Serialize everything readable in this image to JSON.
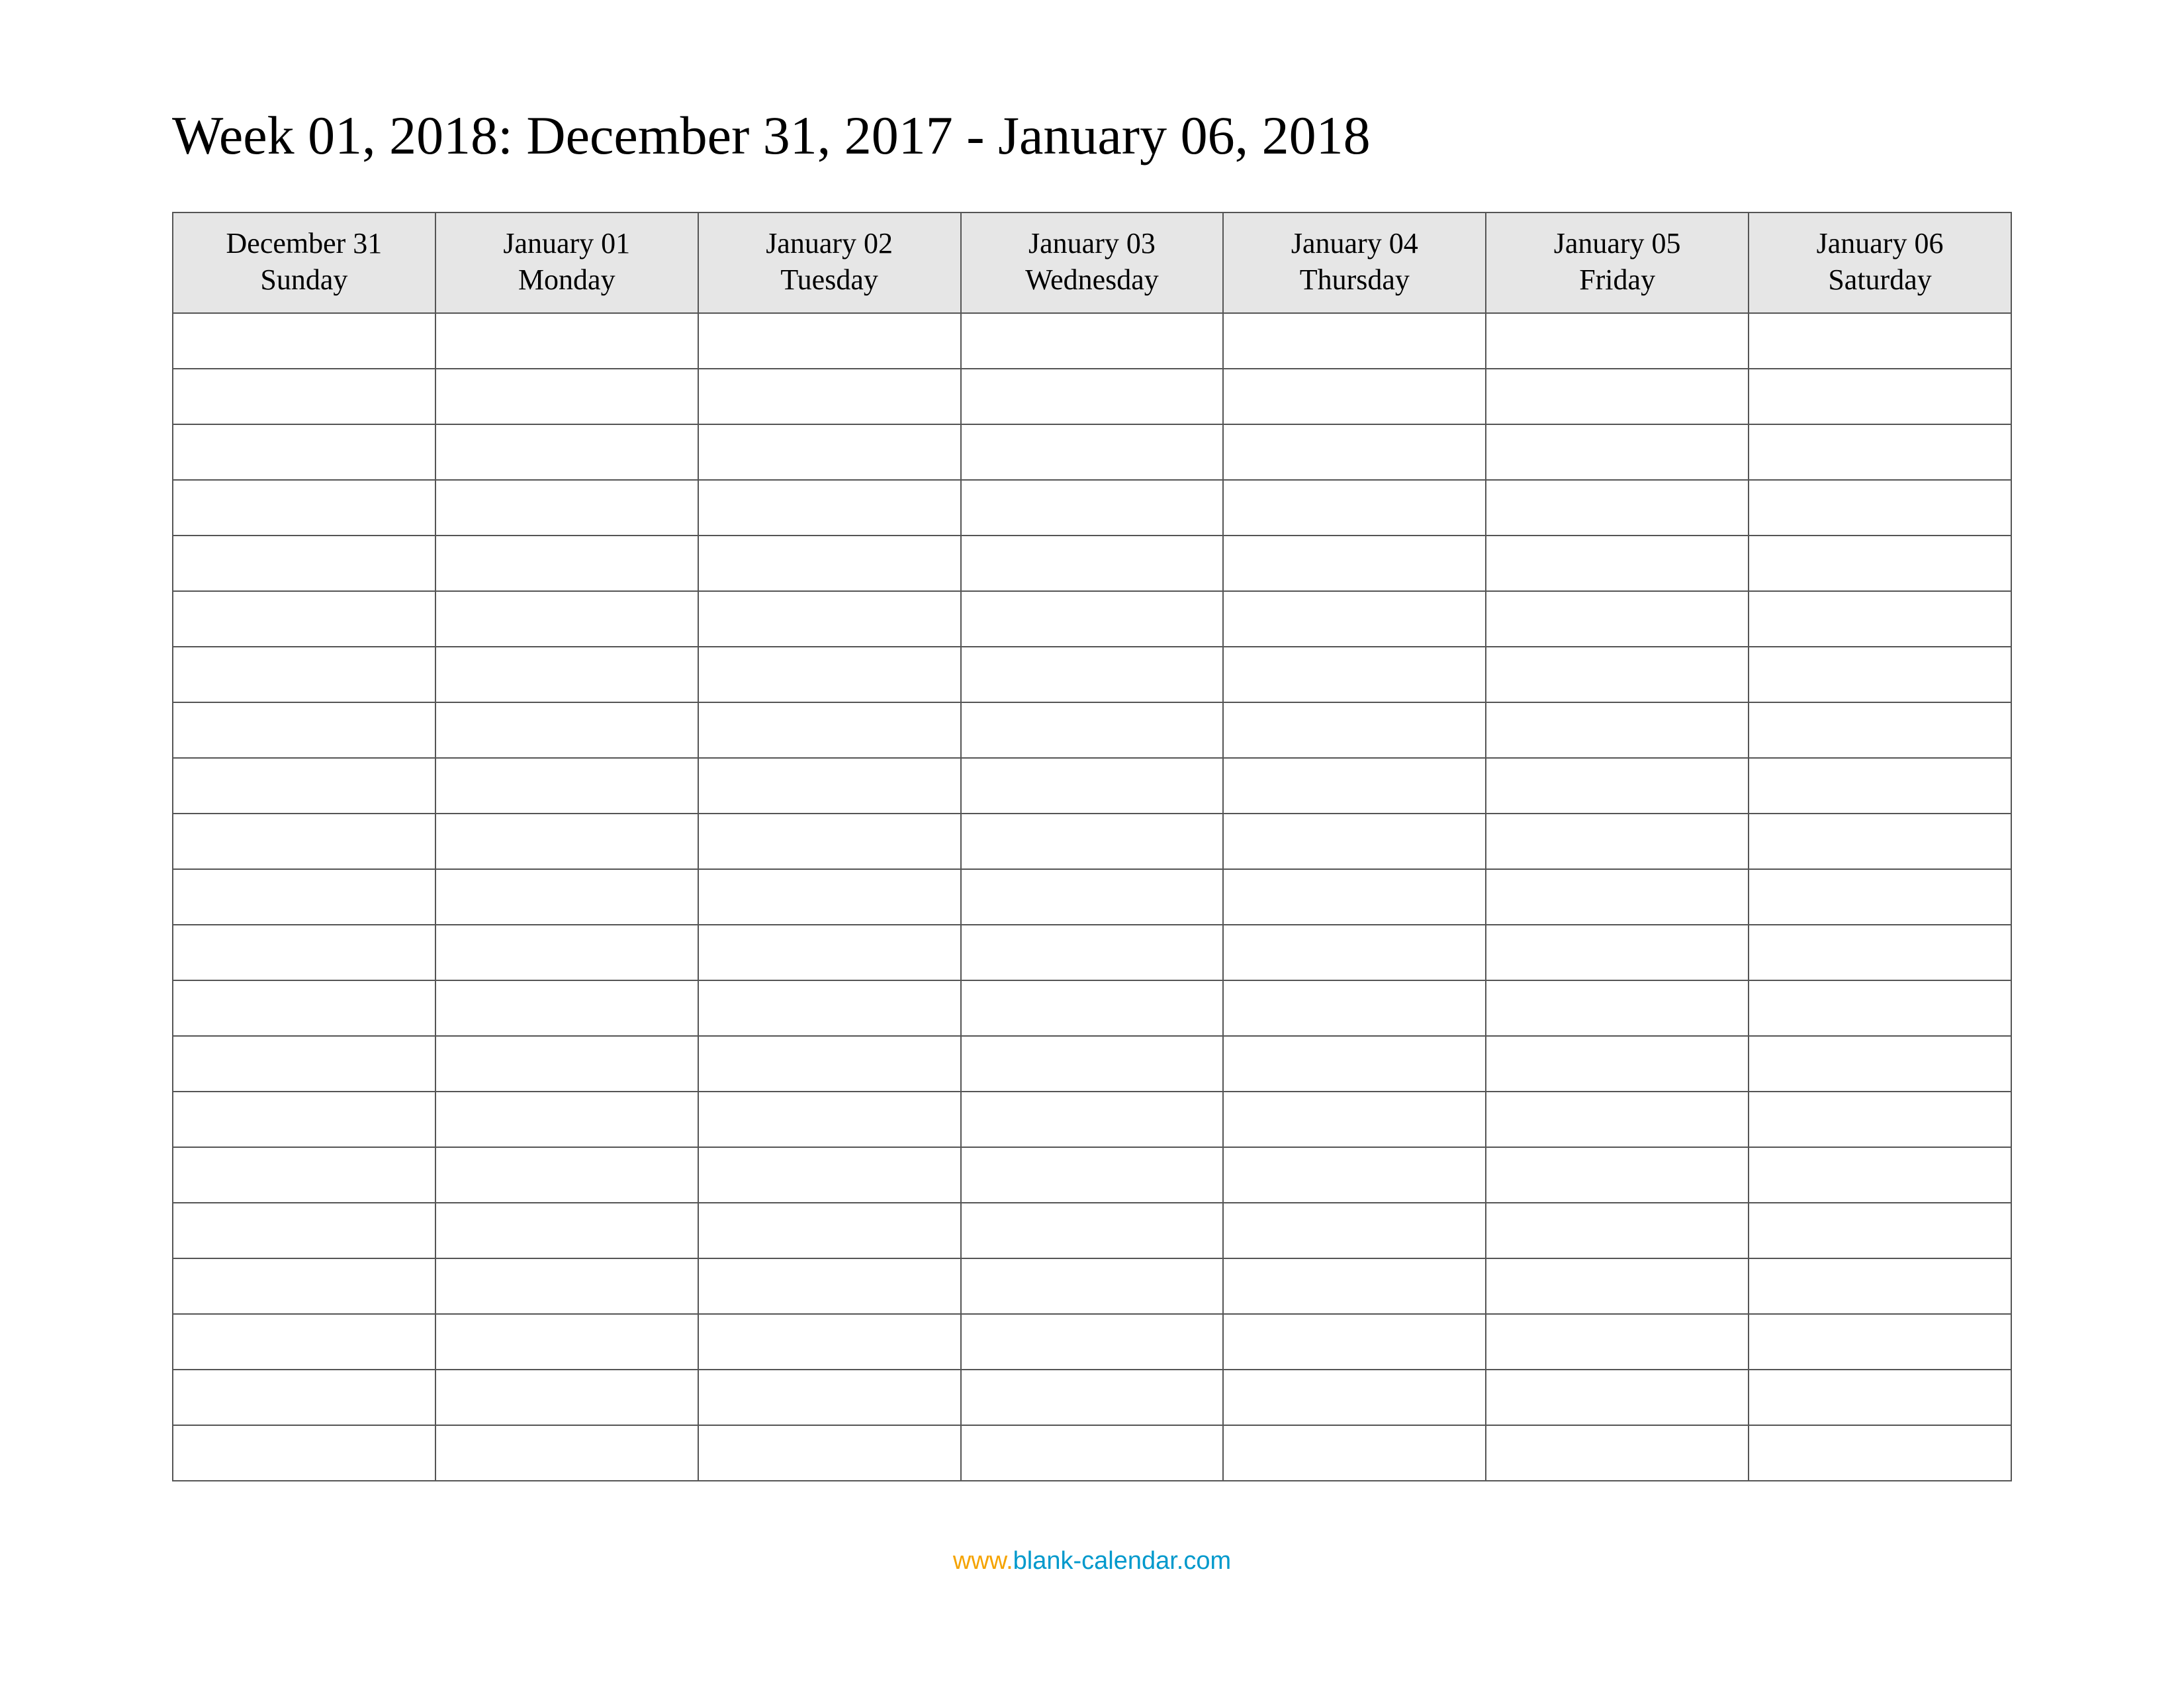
{
  "title": "Week 01, 2018: December 31, 2017 - January 06, 2018",
  "columns": [
    {
      "date": "December 31",
      "day": "Sunday"
    },
    {
      "date": "January 01",
      "day": "Monday"
    },
    {
      "date": "January 02",
      "day": "Tuesday"
    },
    {
      "date": "January 03",
      "day": "Wednesday"
    },
    {
      "date": "January 04",
      "day": "Thursday"
    },
    {
      "date": "January 05",
      "day": "Friday"
    },
    {
      "date": "January 06",
      "day": "Saturday"
    }
  ],
  "row_count": 21,
  "footer": {
    "www": "www.",
    "domain": "blank-calendar.com"
  }
}
